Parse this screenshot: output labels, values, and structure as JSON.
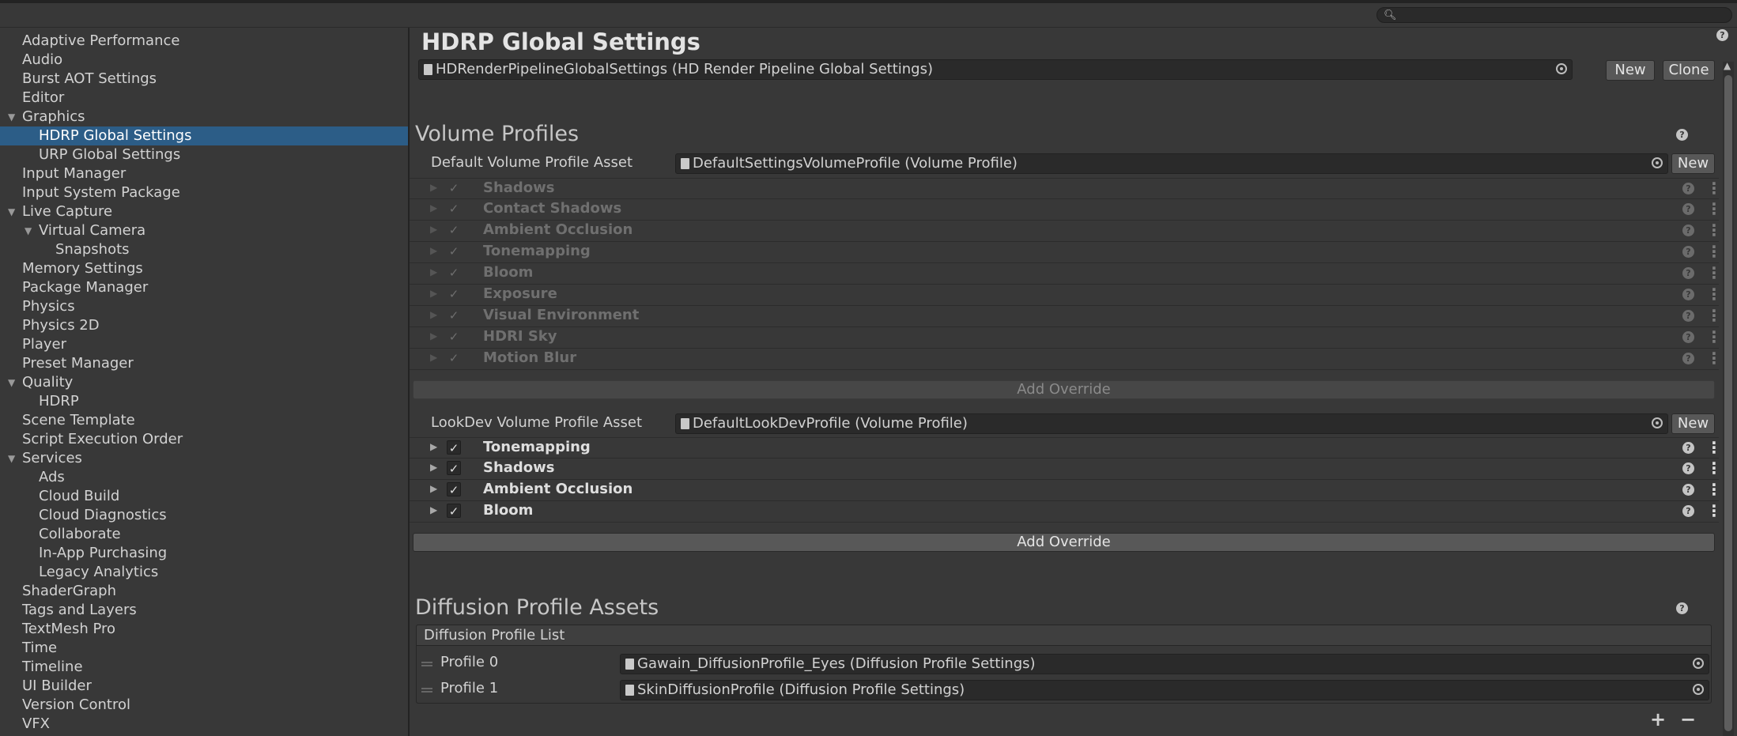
{
  "search": {
    "placeholder": ""
  },
  "sidebar": {
    "items": [
      {
        "label": "Adaptive Performance"
      },
      {
        "label": "Audio"
      },
      {
        "label": "Burst AOT Settings"
      },
      {
        "label": "Editor"
      },
      {
        "label": "Graphics"
      },
      {
        "label": "HDRP Global Settings"
      },
      {
        "label": "URP Global Settings"
      },
      {
        "label": "Input Manager"
      },
      {
        "label": "Input System Package"
      },
      {
        "label": "Live Capture"
      },
      {
        "label": "Virtual Camera"
      },
      {
        "label": "Snapshots"
      },
      {
        "label": "Memory Settings"
      },
      {
        "label": "Package Manager"
      },
      {
        "label": "Physics"
      },
      {
        "label": "Physics 2D"
      },
      {
        "label": "Player"
      },
      {
        "label": "Preset Manager"
      },
      {
        "label": "Quality"
      },
      {
        "label": "HDRP"
      },
      {
        "label": "Scene Template"
      },
      {
        "label": "Script Execution Order"
      },
      {
        "label": "Services"
      },
      {
        "label": "Ads"
      },
      {
        "label": "Cloud Build"
      },
      {
        "label": "Cloud Diagnostics"
      },
      {
        "label": "Collaborate"
      },
      {
        "label": "In-App Purchasing"
      },
      {
        "label": "Legacy Analytics"
      },
      {
        "label": "ShaderGraph"
      },
      {
        "label": "Tags and Layers"
      },
      {
        "label": "TextMesh Pro"
      },
      {
        "label": "Time"
      },
      {
        "label": "Timeline"
      },
      {
        "label": "UI Builder"
      },
      {
        "label": "Version Control"
      },
      {
        "label": "VFX"
      }
    ],
    "selected": "HDRP Global Settings"
  },
  "header": {
    "title": "HDRP Global Settings",
    "asset": "HDRenderPipelineGlobalSettings (HD Render Pipeline Global Settings)",
    "new_label": "New",
    "clone_label": "Clone"
  },
  "volume_profiles": {
    "title": "Volume Profiles",
    "default_label": "Default Volume Profile Asset",
    "default_asset": "DefaultSettingsVolumeProfile (Volume Profile)",
    "default_new": "New",
    "default_overrides": [
      {
        "name": "Shadows"
      },
      {
        "name": "Contact Shadows"
      },
      {
        "name": "Ambient Occlusion"
      },
      {
        "name": "Tonemapping"
      },
      {
        "name": "Bloom"
      },
      {
        "name": "Exposure"
      },
      {
        "name": "Visual Environment"
      },
      {
        "name": "HDRI Sky"
      },
      {
        "name": "Motion Blur"
      }
    ],
    "add_override_label": "Add Override",
    "lookdev_label": "LookDev Volume Profile Asset",
    "lookdev_asset": "DefaultLookDevProfile (Volume Profile)",
    "lookdev_new": "New",
    "lookdev_overrides": [
      {
        "name": "Tonemapping"
      },
      {
        "name": "Shadows"
      },
      {
        "name": "Ambient Occlusion"
      },
      {
        "name": "Bloom"
      }
    ],
    "lookdev_add_override_label": "Add Override"
  },
  "diffusion": {
    "title": "Diffusion Profile Assets",
    "list_label": "Diffusion Profile List",
    "profiles": [
      {
        "label": "Profile 0",
        "asset": "Gawain_DiffusionProfile_Eyes (Diffusion Profile Settings)"
      },
      {
        "label": "Profile 1",
        "asset": "SkinDiffusionProfile (Diffusion Profile Settings)"
      }
    ],
    "add_symbol": "+",
    "remove_symbol": "−"
  },
  "colors": {
    "selection": "#2c5d87",
    "background": "#383838",
    "field": "#2a2a2a"
  }
}
